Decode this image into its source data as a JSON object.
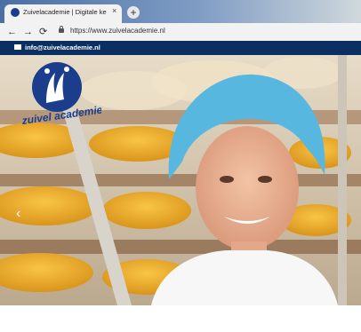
{
  "browser": {
    "tab_title": "Zuivelacademie | Digitale kennis",
    "tab_close": "×",
    "new_tab": "+",
    "url": "https://www.zuivelacademie.nl"
  },
  "topbar": {
    "email": "info@zuivelacademie.nl"
  },
  "logo": {
    "text": "zuivel academie",
    "color": "#1a3e8c"
  },
  "carousel": {
    "prev": "‹"
  }
}
